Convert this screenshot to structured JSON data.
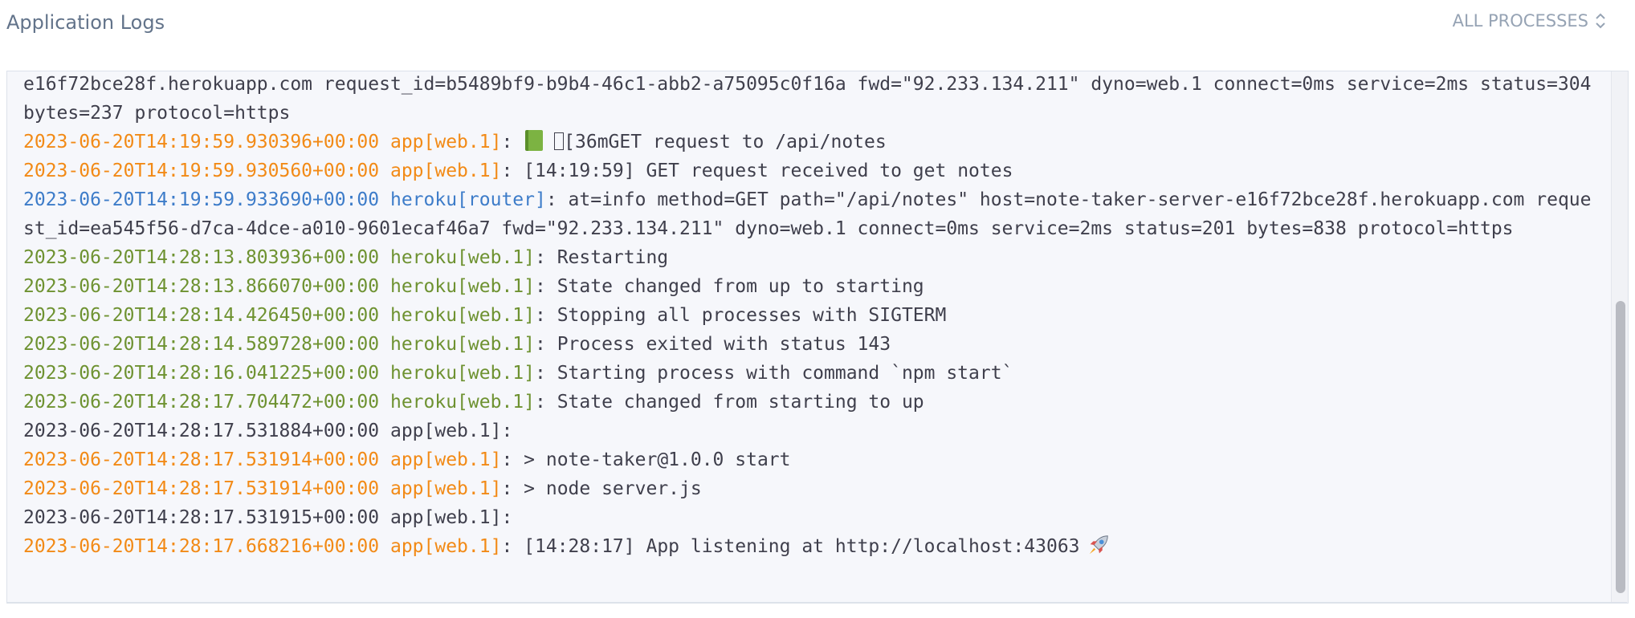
{
  "header": {
    "title": "Application Logs",
    "process_filter": "ALL PROCESSES",
    "filter_icon": "chevron-up-down-icon"
  },
  "colors": {
    "app": "#f28a16",
    "heroku": "#6e9231",
    "router": "#3d7cc9",
    "text": "#3f3f4c"
  },
  "logs": [
    {
      "ts": "",
      "src": "",
      "msg": "e16f72bce28f.herokuapp.com request_id=b5489bf9-b9b4-46c1-abb2-a75095c0f16a fwd=\"92.233.134.211\" dyno=web.1 connect=0ms service=2ms status=304 bytes=237 protocol=https",
      "kind": "plain"
    },
    {
      "ts": "2023-06-20T14:19:59.930396+00:00",
      "src": "app[web.1]",
      "msg": "[36mGET request to /api/notes",
      "kind": "app",
      "icon": "book-icon"
    },
    {
      "ts": "2023-06-20T14:19:59.930560+00:00",
      "src": "app[web.1]",
      "msg": "[14:19:59] GET request received to get notes",
      "kind": "app"
    },
    {
      "ts": "2023-06-20T14:19:59.933690+00:00",
      "src": "heroku[router]",
      "msg": "at=info method=GET path=\"/api/notes\" host=note-taker-server-e16f72bce28f.herokuapp.com request_id=ea545f56-d7ca-4dce-a010-9601ecaf46a7 fwd=\"92.233.134.211\" dyno=web.1 connect=0ms service=2ms status=201 bytes=838 protocol=https",
      "kind": "router"
    },
    {
      "ts": "2023-06-20T14:28:13.803936+00:00",
      "src": "heroku[web.1]",
      "msg": "Restarting",
      "kind": "heroku"
    },
    {
      "ts": "2023-06-20T14:28:13.866070+00:00",
      "src": "heroku[web.1]",
      "msg": "State changed from up to starting",
      "kind": "heroku"
    },
    {
      "ts": "2023-06-20T14:28:14.426450+00:00",
      "src": "heroku[web.1]",
      "msg": "Stopping all processes with SIGTERM",
      "kind": "heroku"
    },
    {
      "ts": "2023-06-20T14:28:14.589728+00:00",
      "src": "heroku[web.1]",
      "msg": "Process exited with status 143",
      "kind": "heroku"
    },
    {
      "ts": "2023-06-20T14:28:16.041225+00:00",
      "src": "heroku[web.1]",
      "msg": "Starting process with command `npm start`",
      "kind": "heroku"
    },
    {
      "ts": "2023-06-20T14:28:17.704472+00:00",
      "src": "heroku[web.1]",
      "msg": "State changed from starting to up",
      "kind": "heroku"
    },
    {
      "ts": "2023-06-20T14:28:17.531884+00:00",
      "src": "app[web.1]",
      "msg": "",
      "kind": "plain"
    },
    {
      "ts": "2023-06-20T14:28:17.531914+00:00",
      "src": "app[web.1]",
      "msg": "> note-taker@1.0.0 start",
      "kind": "app"
    },
    {
      "ts": "2023-06-20T14:28:17.531914+00:00",
      "src": "app[web.1]",
      "msg": "> node server.js",
      "kind": "app"
    },
    {
      "ts": "2023-06-20T14:28:17.531915+00:00",
      "src": "app[web.1]",
      "msg": "",
      "kind": "plain"
    },
    {
      "ts": "2023-06-20T14:28:17.668216+00:00",
      "src": "app[web.1]",
      "msg": "[14:28:17] App listening at http://localhost:43063",
      "kind": "app",
      "icon": "rocket-icon"
    }
  ]
}
